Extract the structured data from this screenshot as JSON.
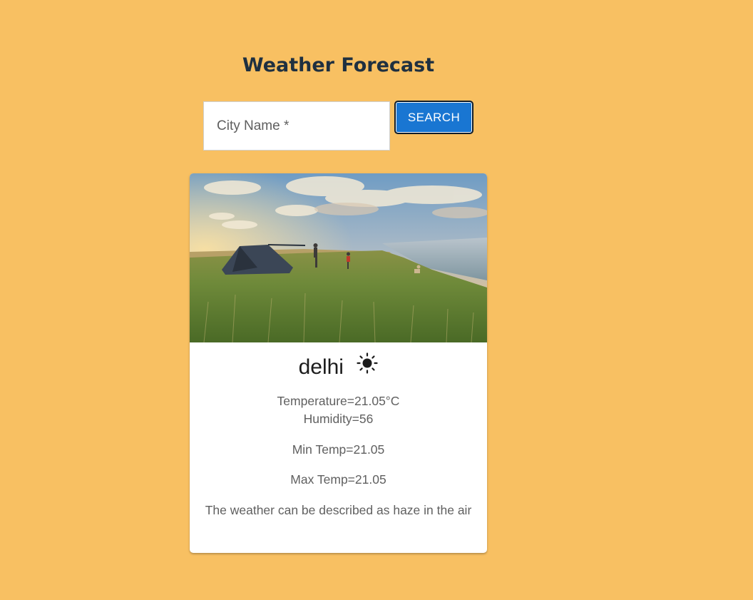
{
  "header": {
    "title": "Weather Forecast"
  },
  "search": {
    "placeholder": "City Name *",
    "button_label": "SEARCH"
  },
  "card": {
    "city": "delhi",
    "weather_icon": "sun-icon",
    "temperature": "Temperature=21.05°C",
    "humidity": "Humidity=56",
    "min_temp": "Min Temp=21.05",
    "max_temp": "Max Temp=21.05",
    "description": "The weather can be described as haze in the air"
  },
  "colors": {
    "background": "#f8c062",
    "button": "#1976d2",
    "title": "#1f3040"
  }
}
